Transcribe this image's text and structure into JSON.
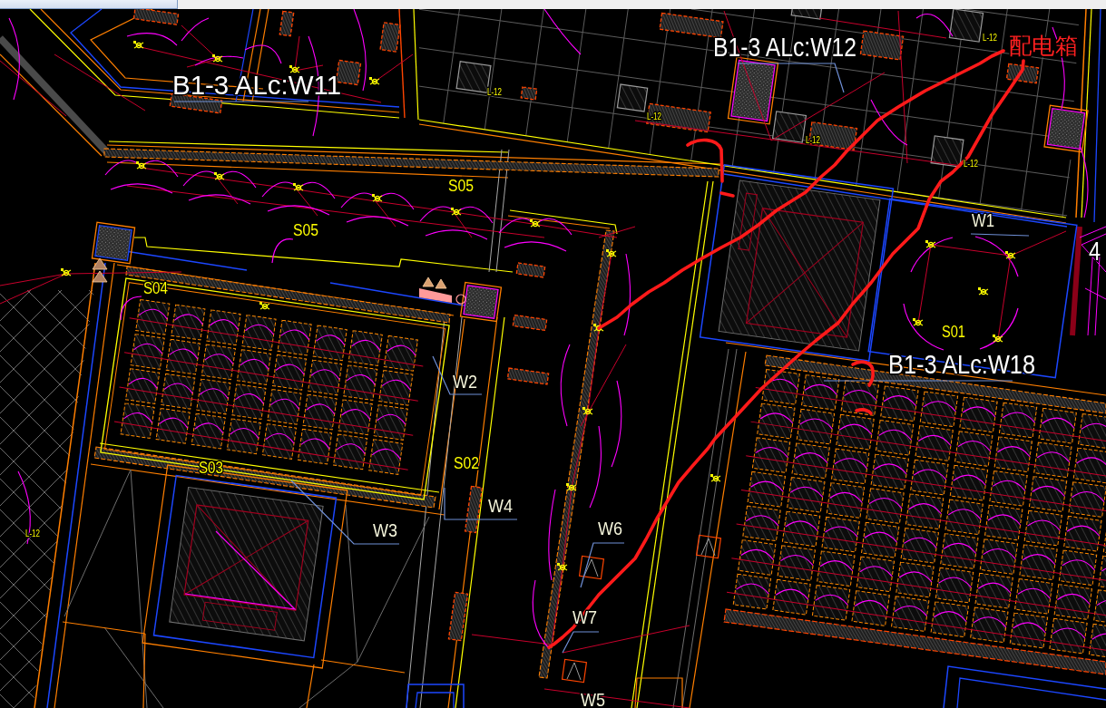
{
  "drawing": {
    "labels": [
      {
        "kind": "circuit",
        "text": "B1-3 ALc:W12"
      },
      {
        "kind": "level",
        "text": "L-12"
      },
      {
        "kind": "markup",
        "text": "配电箱"
      },
      {
        "kind": "circuit",
        "text": "B1-3 ALc:W11"
      },
      {
        "kind": "level",
        "text": "L-12"
      },
      {
        "kind": "level",
        "text": "L-12"
      },
      {
        "kind": "level",
        "text": "L-12"
      },
      {
        "kind": "level",
        "text": "L-12"
      },
      {
        "kind": "zone",
        "text": "S05"
      },
      {
        "kind": "zone",
        "text": "S05"
      },
      {
        "kind": "tag",
        "text": "W1"
      },
      {
        "kind": "number",
        "text": "4"
      },
      {
        "kind": "zone",
        "text": "S04"
      },
      {
        "kind": "zone",
        "text": "S01"
      },
      {
        "kind": "tag",
        "text": "W2"
      },
      {
        "kind": "circuit",
        "text": "B1-3 ALc:W18"
      },
      {
        "kind": "zone",
        "text": "S03"
      },
      {
        "kind": "zone",
        "text": "S02"
      },
      {
        "kind": "tag",
        "text": "W4"
      },
      {
        "kind": "level",
        "text": "L-12"
      },
      {
        "kind": "tag",
        "text": "W3"
      },
      {
        "kind": "tag",
        "text": "W6"
      },
      {
        "kind": "tag",
        "text": "W7"
      },
      {
        "kind": "tag",
        "text": "W5"
      }
    ]
  }
}
